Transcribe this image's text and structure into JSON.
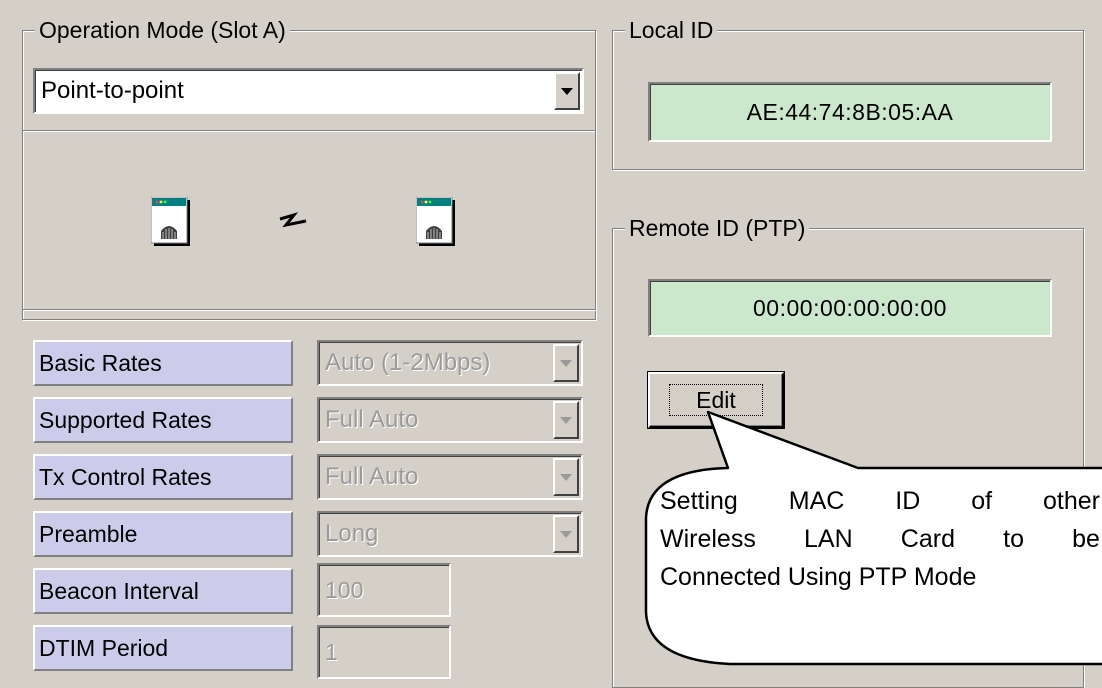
{
  "operation_mode": {
    "legend": "Operation Mode (Slot A)",
    "selected": "Point-to-point"
  },
  "properties": [
    {
      "label": "Basic Rates",
      "value": "Auto (1-2Mbps)",
      "control": "combo"
    },
    {
      "label": "Supported Rates",
      "value": "Full Auto",
      "control": "combo"
    },
    {
      "label": "Tx Control Rates",
      "value": "Full Auto",
      "control": "combo"
    },
    {
      "label": "Preamble",
      "value": "Long",
      "control": "combo"
    },
    {
      "label": "Beacon Interval",
      "value": "100",
      "control": "field"
    },
    {
      "label": "DTIM Period",
      "value": "1",
      "control": "field"
    }
  ],
  "local_id": {
    "legend": "Local ID",
    "value": "AE:44:74:8B:05:AA"
  },
  "remote_id": {
    "legend": "Remote ID (PTP)",
    "value": "00:00:00:00:00:00",
    "edit_label": "Edit"
  },
  "callout": {
    "line1": [
      "Setting",
      "MAC",
      "ID",
      "of",
      "other"
    ],
    "line2": [
      "Wireless",
      "LAN",
      "Card",
      "to",
      "be"
    ],
    "line3": "Connected Using PTP Mode"
  },
  "icons": {
    "station": "computer-station-icon",
    "link": "wireless-link-icon"
  },
  "colors": {
    "window_bg": "#d4d0c8",
    "label_bg": "#ccccea",
    "id_bg": "#cce8cc",
    "disabled_text": "#9a9a9a"
  }
}
